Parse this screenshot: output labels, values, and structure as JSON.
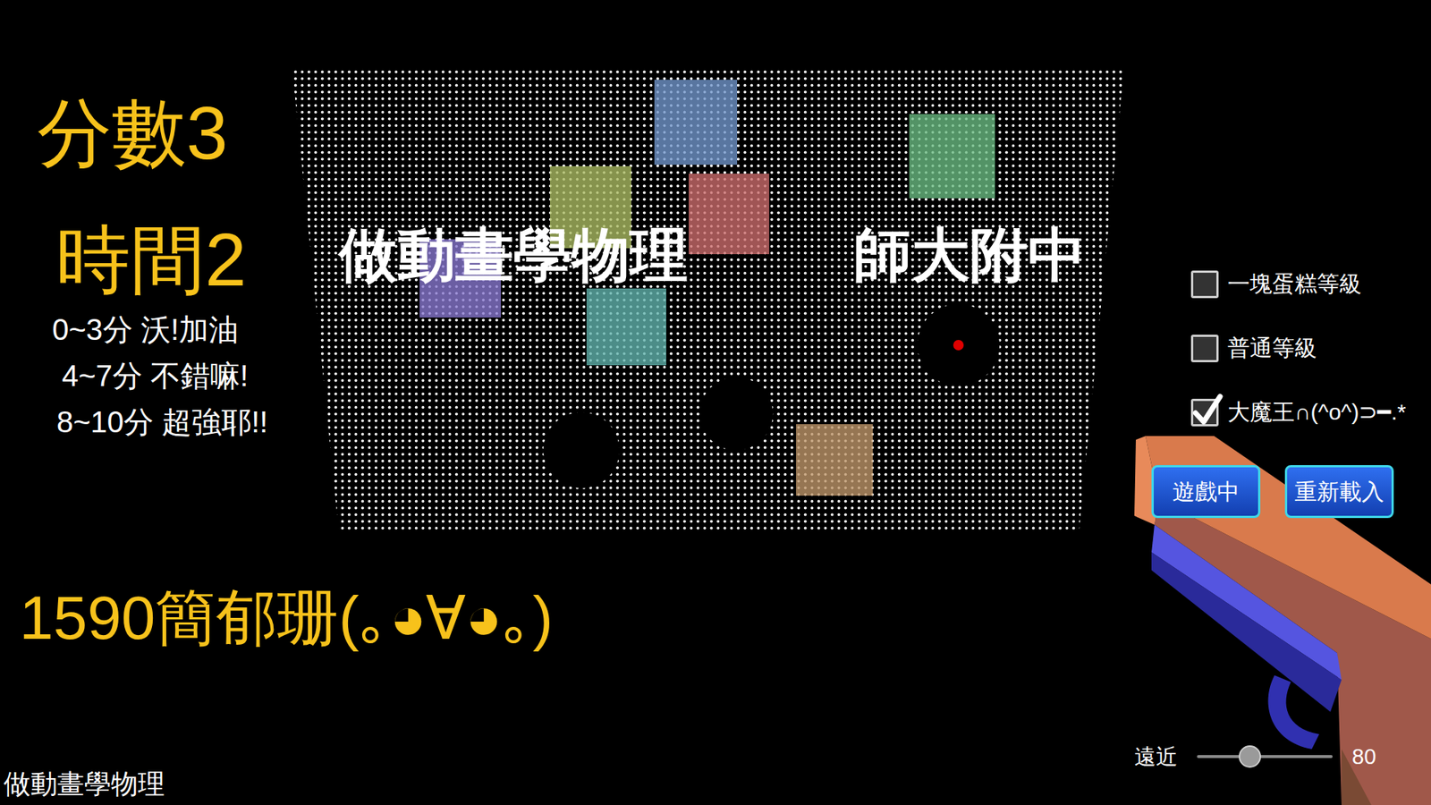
{
  "hud": {
    "score": "分數3",
    "time": "時間2",
    "ratings": [
      "0~3分 沃!加油",
      "4~7分 不錯嘛!",
      "8~10分 超強耶!!"
    ],
    "player": "1590簡郁珊(｡◕∀◕｡)",
    "footer": "做動畫學物理"
  },
  "wall": {
    "labels": [
      "做動畫學物理",
      "師大附中"
    ],
    "targets": [
      {
        "color": "#6f93c8"
      },
      {
        "color": "#a8b860"
      },
      {
        "color": "#c86a6a"
      },
      {
        "color": "#8676cc"
      },
      {
        "color": "#5fb0aa"
      },
      {
        "color": "#68b880"
      },
      {
        "color": "#bc9468"
      }
    ],
    "holes": [
      {
        "marked": true
      },
      {
        "marked": false
      },
      {
        "marked": false
      }
    ]
  },
  "levels": [
    {
      "label": "一塊蛋糕等級",
      "checked": false
    },
    {
      "label": "普通等級",
      "checked": false
    },
    {
      "label": "大魔王∩(^o^)⊃━.*",
      "checked": true
    }
  ],
  "buttons": [
    {
      "label": "遊戲中"
    },
    {
      "label": "重新載入"
    }
  ],
  "slider": {
    "label": "遠近",
    "level": 0.39,
    "reading": "80"
  }
}
